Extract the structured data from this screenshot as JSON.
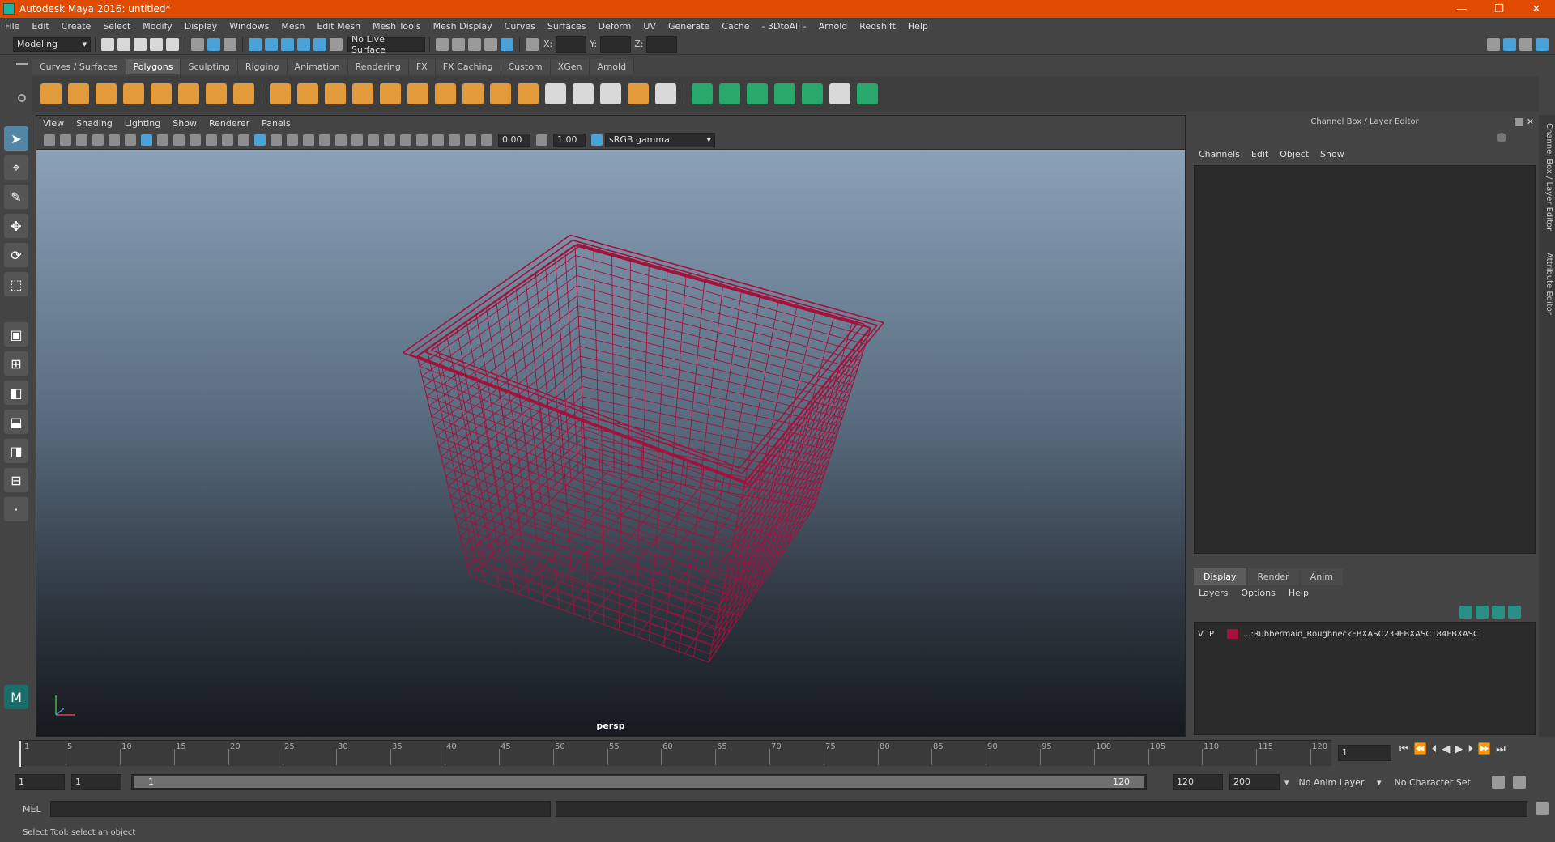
{
  "app": {
    "title": "Autodesk Maya 2016: untitled*",
    "window_controls": [
      "—",
      "❐",
      "✕"
    ]
  },
  "menus": [
    "File",
    "Edit",
    "Create",
    "Select",
    "Modify",
    "Display",
    "Windows",
    "Mesh",
    "Edit Mesh",
    "Mesh Tools",
    "Mesh Display",
    "Curves",
    "Surfaces",
    "Deform",
    "UV",
    "Generate",
    "Cache",
    "- 3DtoAll -",
    "Arnold",
    "Redshift",
    "Help"
  ],
  "status_line": {
    "mode": "Modeling",
    "live_surface": "No Live Surface",
    "x_label": "X:",
    "y_label": "Y:",
    "z_label": "Z:"
  },
  "shelf": {
    "tabs": [
      "Curves / Surfaces",
      "Polygons",
      "Sculpting",
      "Rigging",
      "Animation",
      "Rendering",
      "FX",
      "FX Caching",
      "Custom",
      "XGen",
      "Arnold"
    ],
    "active_tab": "Polygons"
  },
  "viewport": {
    "menu": [
      "View",
      "Shading",
      "Lighting",
      "Show",
      "Renderer",
      "Panels"
    ],
    "exposure": "0.00",
    "gamma": "1.00",
    "color_space": "sRGB gamma",
    "camera_label": "persp",
    "wire_color": "#a3123c"
  },
  "channel_box": {
    "header": "Channel Box / Layer Editor",
    "menu": [
      "Channels",
      "Edit",
      "Object",
      "Show"
    ]
  },
  "layer_editor": {
    "tabs": [
      "Display",
      "Render",
      "Anim"
    ],
    "active_tab": "Display",
    "menu": [
      "Layers",
      "Options",
      "Help"
    ],
    "layer": {
      "v": "V",
      "p": "P",
      "name": "...:Rubbermaid_RoughneckFBXASC239FBXASC184FBXASC"
    }
  },
  "side_tabs": [
    "Channel Box / Layer Editor",
    "Attribute Editor"
  ],
  "timeline": {
    "ticks": [
      "1",
      "5",
      "10",
      "15",
      "20",
      "25",
      "30",
      "35",
      "40",
      "45",
      "50",
      "55",
      "60",
      "65",
      "70",
      "75",
      "80",
      "85",
      "90",
      "95",
      "100",
      "105",
      "110",
      "115",
      "120"
    ],
    "current_frame": "1"
  },
  "range": {
    "start": "1",
    "current": "1",
    "slider_start": "1",
    "slider_end": "120",
    "end": "120",
    "max": "200",
    "anim_layer": "No Anim Layer",
    "char_set": "No Character Set"
  },
  "command_line": {
    "label": "MEL"
  },
  "help_line": "Select Tool: select an object"
}
